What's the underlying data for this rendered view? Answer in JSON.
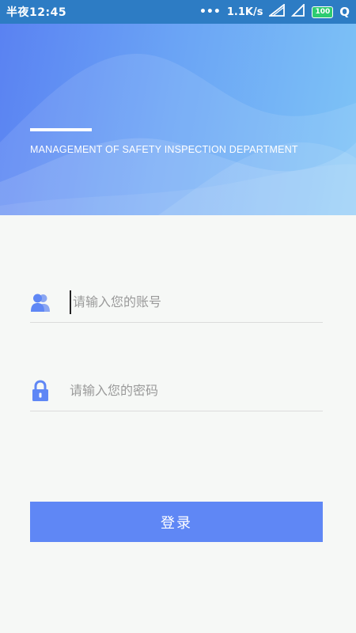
{
  "status_bar": {
    "time": "半夜12:45",
    "network_speed": "1.1K/s",
    "battery": "100",
    "q_label": "Q"
  },
  "header": {
    "subtitle": "MANAGEMENT OF SAFETY INSPECTION DEPARTMENT"
  },
  "form": {
    "account_placeholder": "请输入您的账号",
    "password_placeholder": "请输入您的密码",
    "login_label": "登录"
  },
  "colors": {
    "accent": "#5f87f5",
    "status_bar": "#2d7cc4"
  },
  "icons": {
    "account": "user-group-icon",
    "password": "padlock-icon"
  }
}
